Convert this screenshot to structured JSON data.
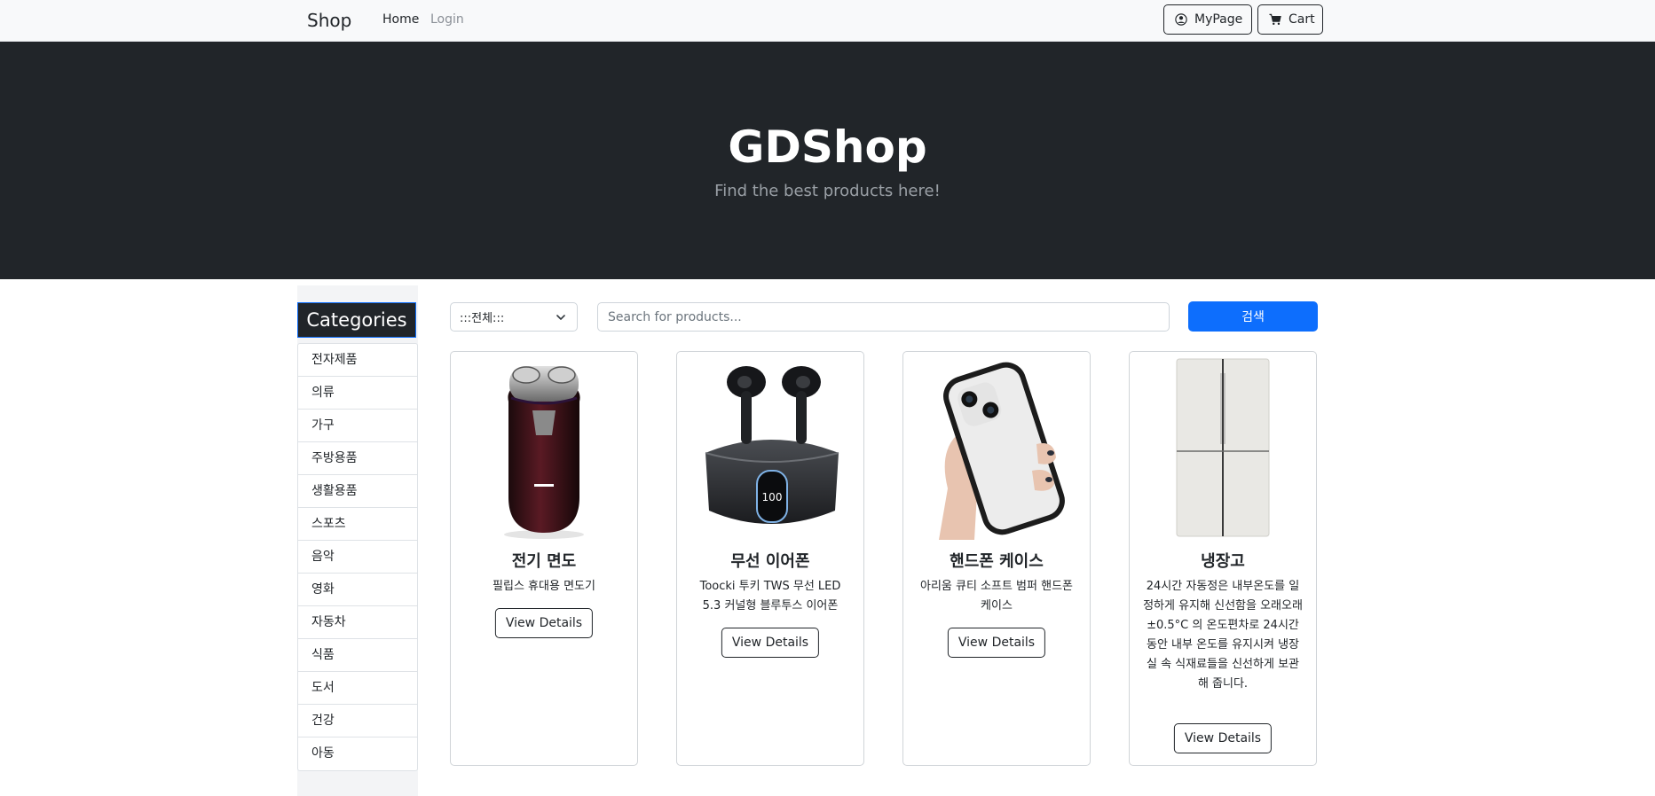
{
  "navbar": {
    "brand": "Shop",
    "links": [
      {
        "label": "Home"
      },
      {
        "label": "Login"
      }
    ],
    "mypage_label": "MyPage",
    "cart_label": "Cart"
  },
  "hero": {
    "title": "GDShop",
    "subtitle": "Find the best products here!"
  },
  "sidebar": {
    "header": "Categories",
    "items": [
      "전자제품",
      "의류",
      "가구",
      "주방용품",
      "생활용품",
      "스포츠",
      "음악",
      "영화",
      "자동차",
      "식품",
      "도서",
      "건강",
      "아동"
    ]
  },
  "filter": {
    "selected_category": ":::전체:::",
    "search_placeholder": "Search for products...",
    "search_button": "검색"
  },
  "products": [
    {
      "title": "전기 면도",
      "description": "필립스 휴대용 면도기",
      "button": "View Details",
      "image": "electric-shaver-image"
    },
    {
      "title": "무선 이어폰",
      "description": "Toocki 투키 TWS 무선 LED 5.3 커널형 블루투스 이어폰",
      "button": "View Details",
      "image": "wireless-earbuds-image"
    },
    {
      "title": "핸드폰 케이스",
      "description": "아리움 큐티 소프트 범퍼 핸드폰 케이스",
      "button": "View Details",
      "image": "phone-case-image"
    },
    {
      "title": "냉장고",
      "description": "24시간 자동정은 내부온도를 일정하게 유지해 신선함을 오래오래 ±0.5°C 의 온도편차로 24시간 동안 내부 온도를 유지시켜 냉장실 속 식재료들을 신선하게 보관해 줍니다.",
      "button": "View Details",
      "image": "refrigerator-image"
    }
  ],
  "colors": {
    "navbar_bg": "#f8f9fa",
    "hero_bg": "#212529",
    "primary": "#0d6efd"
  }
}
